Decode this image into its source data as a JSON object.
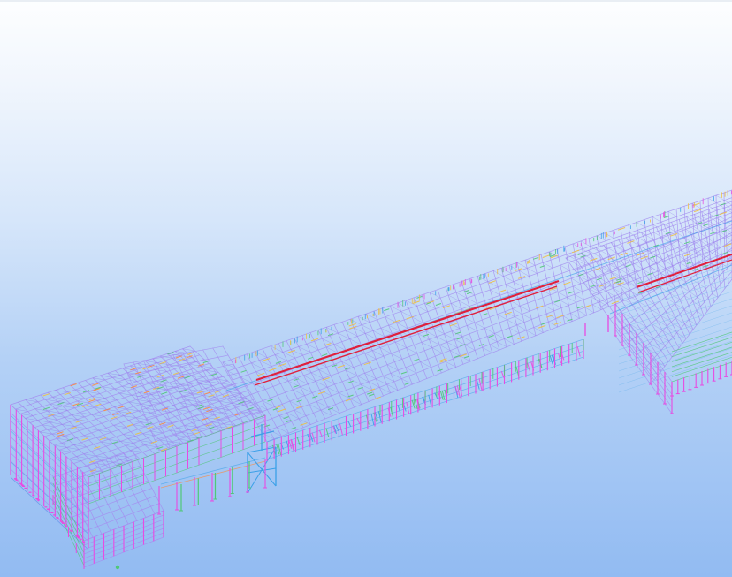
{
  "viewport": {
    "view": "3D",
    "background_top": "#fdfeff",
    "background_bottom": "#92bbf2"
  },
  "model": {
    "object": "steel-structure-wireframe",
    "member_colors": {
      "beams": "#a48ef0",
      "bracing": "#8c78e8",
      "columns": "#e84be2",
      "crane-rail": "#e0203c",
      "secondary": "#50c878",
      "purlins": "#f0c040",
      "frames": "#3aa0e8",
      "ties": "#ff8a3d"
    }
  }
}
